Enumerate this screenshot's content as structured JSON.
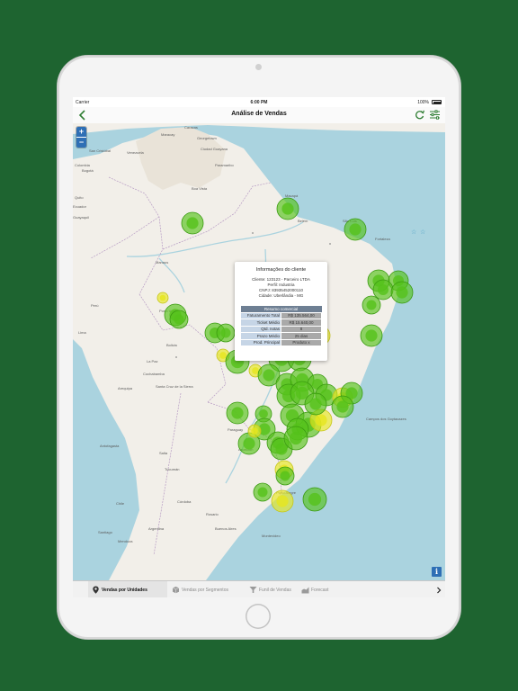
{
  "status_bar": {
    "carrier": "Carrier",
    "time": "6:00 PM",
    "battery": "100%"
  },
  "nav": {
    "title": "Análise de Vendas",
    "back_icon": "chevron-left-icon",
    "refresh_icon": "refresh-icon",
    "filter_icon": "sliders-icon"
  },
  "map": {
    "zoom_in": "+",
    "zoom_out": "−",
    "info": "i",
    "labels": [
      {
        "id": "caracas",
        "text": "Caracas"
      },
      {
        "id": "georgetown",
        "text": "Georgetown"
      },
      {
        "id": "paramaribo",
        "text": "Paramaribo"
      },
      {
        "id": "colombia",
        "text": "Colombia"
      },
      {
        "id": "bogota",
        "text": "Bogotá"
      },
      {
        "id": "venezuela",
        "text": "Venezuela"
      },
      {
        "id": "ecuador",
        "text": "Ecuador"
      },
      {
        "id": "quito",
        "text": "Quito"
      },
      {
        "id": "guayaquil",
        "text": "Guayaquil"
      },
      {
        "id": "macapa",
        "text": "Macapá"
      },
      {
        "id": "belem",
        "text": "Belém"
      },
      {
        "id": "sao-luis",
        "text": "São Luís"
      },
      {
        "id": "fortaleza",
        "text": "Fortaleza"
      },
      {
        "id": "manaus",
        "text": "Manaus"
      },
      {
        "id": "peru",
        "text": "Perú"
      },
      {
        "id": "lima",
        "text": "Lima"
      },
      {
        "id": "bolivia",
        "text": "Bolivia"
      },
      {
        "id": "la-paz",
        "text": "La Paz"
      },
      {
        "id": "cochabamba",
        "text": "Cochabamba"
      },
      {
        "id": "santa-cruz",
        "text": "Santa Cruz de la Sierra"
      },
      {
        "id": "arequipa",
        "text": "Arequipa"
      },
      {
        "id": "paraguay",
        "text": "Paraguay"
      },
      {
        "id": "asuncion",
        "text": "Asunción"
      },
      {
        "id": "salta",
        "text": "Salta"
      },
      {
        "id": "tucuman",
        "text": "Tucumán"
      },
      {
        "id": "cordoba",
        "text": "Córdoba"
      },
      {
        "id": "rosario",
        "text": "Rosario"
      },
      {
        "id": "buenos-aires",
        "text": "Buenos Aires"
      },
      {
        "id": "montevideo",
        "text": "Montevideo"
      },
      {
        "id": "argentina",
        "text": "Argentina"
      },
      {
        "id": "chile",
        "text": "Chile"
      },
      {
        "id": "santiago",
        "text": "Santiago"
      },
      {
        "id": "antofagasta",
        "text": "Antofagasta"
      },
      {
        "id": "porto-alegre",
        "text": "Porto Alegre"
      },
      {
        "id": "campos",
        "text": "Campos dos Goytacazes"
      },
      {
        "id": "mendoza",
        "text": "Mendoza"
      },
      {
        "id": "san-cristobal",
        "text": "San Cristóbal"
      },
      {
        "id": "maracay",
        "text": "Maracay"
      },
      {
        "id": "ciudad-guayana",
        "text": "Ciudad Guayana"
      },
      {
        "id": "boa-vista",
        "text": "Boa Vista"
      },
      {
        "id": "porto-velho",
        "text": "Porto Velho"
      }
    ]
  },
  "popup": {
    "title": "Informações do cliente",
    "cliente": "Cliente: 123123 - Parceiro LTDA",
    "perfil": "Perfil: Industria",
    "cnpj": "CNPJ: 83935452000110",
    "cidade": "Cidade: Uberlândia - MG",
    "summary_header": "Resumo comercial",
    "rows": [
      {
        "label": "Faturamento Total",
        "value": "R$ 135.564,00"
      },
      {
        "label": "Ticket Médio",
        "value": "R$ 15.640,00"
      },
      {
        "label": "Qtd. notas",
        "value": "8"
      },
      {
        "label": "Prazo Médio",
        "value": "25 dias"
      },
      {
        "label": "Prod. Principal",
        "value": "Produto x"
      }
    ]
  },
  "tabs": [
    {
      "label": "Vendas por Unidades",
      "icon": "map-pin-icon",
      "active": true
    },
    {
      "label": "Vendas por Segmentos",
      "icon": "box-icon",
      "active": false
    },
    {
      "label": "Funil de Vendas",
      "icon": "funnel-icon",
      "active": false
    },
    {
      "label": "Forecast",
      "icon": "chart-icon",
      "active": false
    }
  ],
  "tabs_next_icon": "chevron-right-icon",
  "colors": {
    "background": "#1e6430",
    "accent": "#2e7d32",
    "marker_green": "#55c21a",
    "marker_yellow": "#e6e61e",
    "water": "#aad3df",
    "land": "#f2efe9"
  }
}
